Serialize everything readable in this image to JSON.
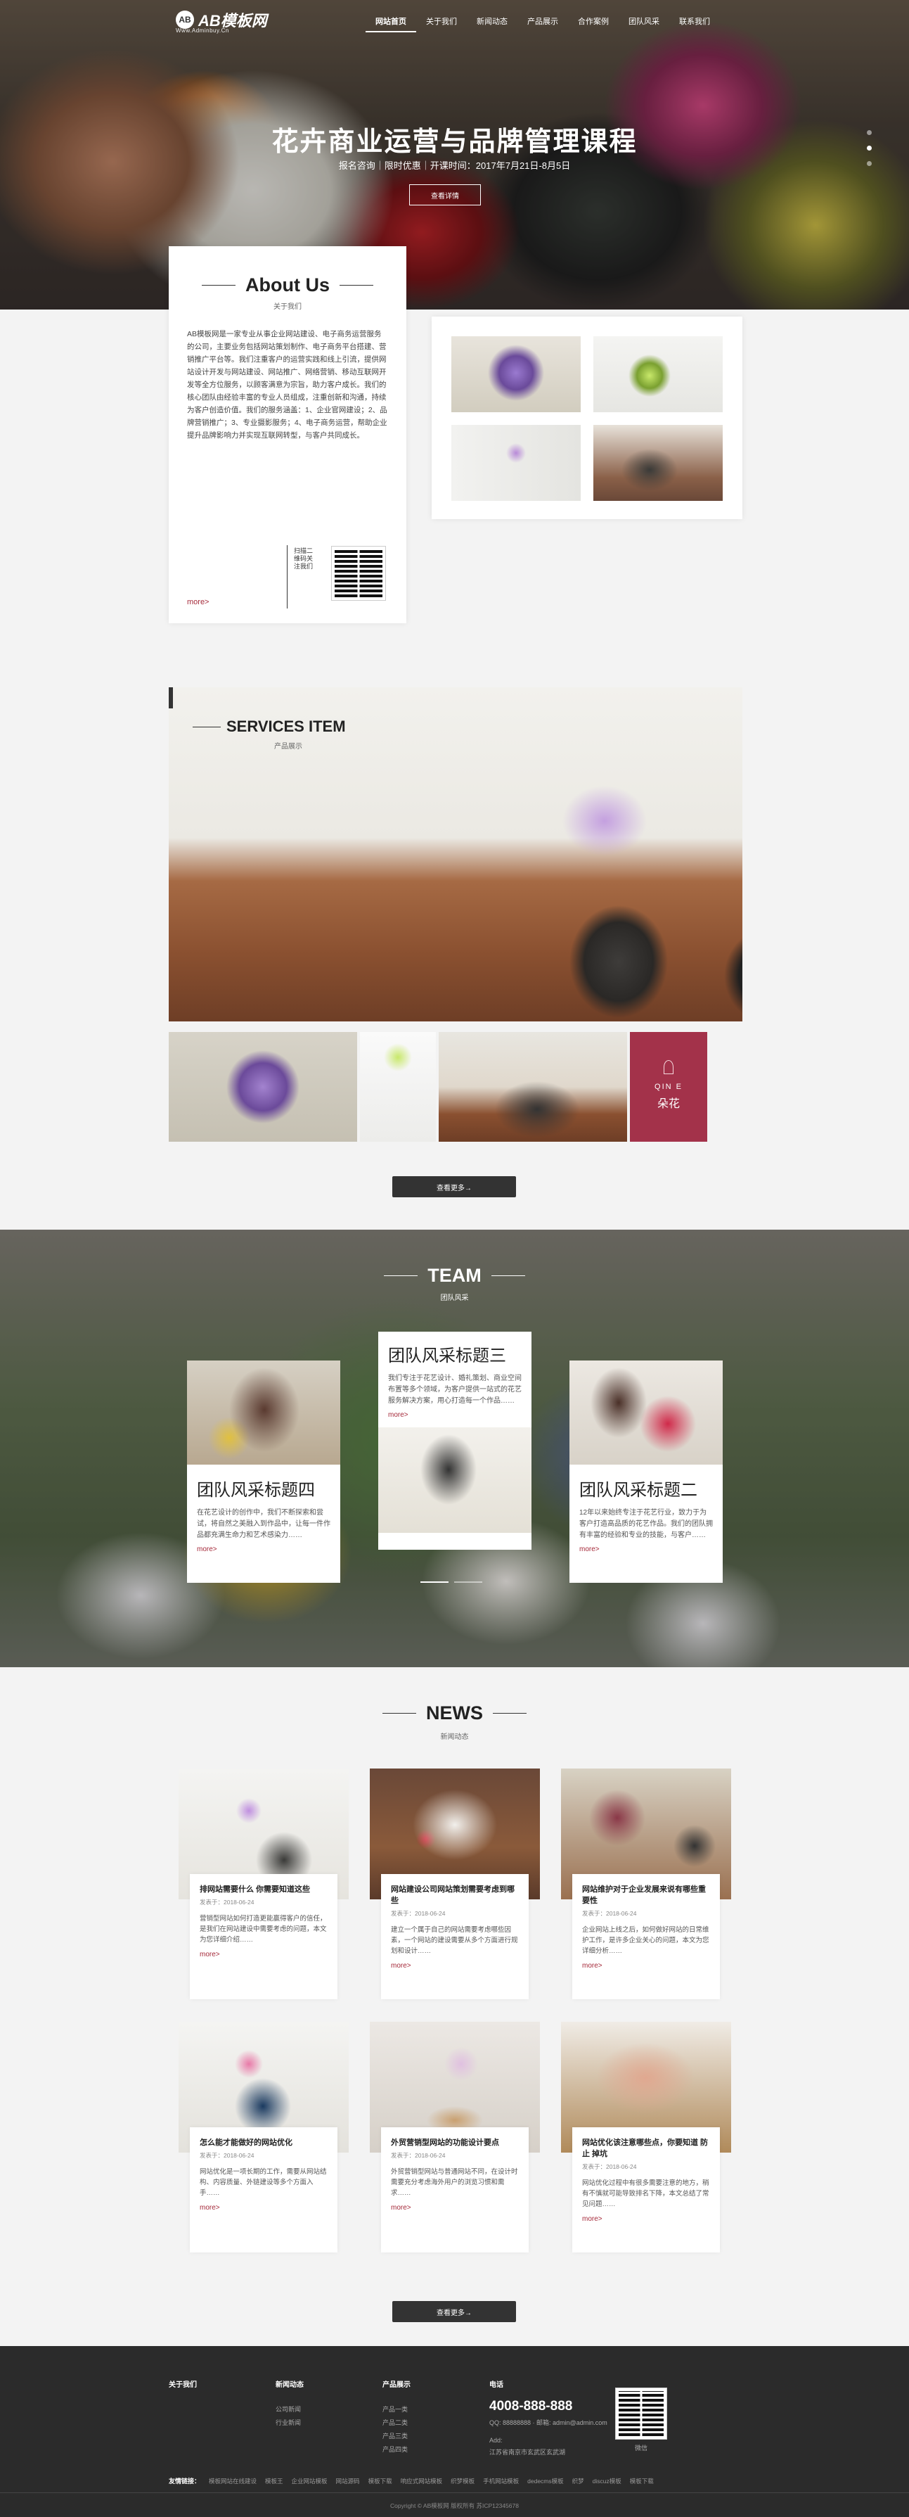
{
  "header": {
    "logo_mark": "AB",
    "logo_text": "AB模板网",
    "logo_sub": "Www.Adminbuy.Cn",
    "nav": [
      "网站首页",
      "关于我们",
      "新闻动态",
      "产品展示",
      "合作案例",
      "团队风采",
      "联系我们"
    ],
    "active_index": 0
  },
  "hero": {
    "title": "花卉商业运营与品牌管理课程",
    "subtitle": "报名咨询｜限时优惠｜开课时间：2017年7月21日-8月5日",
    "button": "查看详情"
  },
  "about": {
    "title": "About Us",
    "subtitle": "关于我们",
    "text": "AB模板网是一家专业从事企业网站建设、电子商务运营服务的公司，主要业务包括网站策划制作、电子商务平台搭建、营销推广平台等。我们注重客户的运营实践和线上引流，提供网站设计开发与网站建设、网站推广、网络营销、移动互联网开发等全方位服务，以顾客满意为宗旨，助力客户成长。我们的核心团队由经验丰富的专业人员组成，注重创新和沟通，持续为客户创造价值。我们的服务涵盖：1、企业官网建设；2、品牌营销推广；3、专业摄影服务；4、电子商务运营，帮助企业提升品牌影响力并实现互联网转型，与客户共同成长。",
    "qr_caption": "扫描二维码关注我们",
    "more": "more>"
  },
  "services": {
    "title": "SERVICES ITEM",
    "subtitle": "产品展示",
    "brand_en": "QIN E",
    "brand_cn": "朵花",
    "button": "查看更多→"
  },
  "team": {
    "title": "TEAM",
    "subtitle": "团队风采",
    "cards": [
      {
        "title": "团队风采标题四",
        "text": "在花艺设计的创作中，我们不断探索和尝试，将自然之美融入到作品中，让每一件作品都充满生命力和艺术感染力……",
        "more": "more>"
      },
      {
        "title": "团队风采标题三",
        "text": "我们专注于花艺设计、婚礼策划、商业空间布置等多个领域，为客户提供一站式的花艺服务解决方案，用心打造每一个作品……",
        "more": "more>"
      },
      {
        "title": "团队风采标题二",
        "text": "12年以来始终专注于花艺行业，致力于为客户打造高品质的花艺作品。我们的团队拥有丰富的经验和专业的技能，与客户……",
        "more": "more>"
      }
    ]
  },
  "news": {
    "title": "NEWS",
    "subtitle": "新闻动态",
    "button": "查看更多→",
    "items": [
      {
        "title": "排网站需要什么 你需要知道这些",
        "date": "发表于：2018-06-24",
        "text": "营销型网站如何打造更能赢得客户的信任，是我们在网站建设中需要考虑的问题，本文为您详细介绍……",
        "more": "more>"
      },
      {
        "title": "网站建设公司网站策划需要考虑到哪些",
        "date": "发表于：2018-06-24",
        "text": "建立一个属于自己的网站需要考虑哪些因素，一个网站的建设需要从多个方面进行规划和设计……",
        "more": "more>"
      },
      {
        "title": "网站维护对于企业发展来说有哪些重要性",
        "date": "发表于：2018-06-24",
        "text": "企业网站上线之后，如何做好网站的日常维护工作，是许多企业关心的问题，本文为您详细分析……",
        "more": "more>"
      },
      {
        "title": "怎么能才能做好的网站优化",
        "date": "发表于：2018-06-24",
        "text": "网站优化是一项长期的工作，需要从网站结构、内容质量、外链建设等多个方面入手……",
        "more": "more>"
      },
      {
        "title": "外贸营销型网站的功能设计要点",
        "date": "发表于：2018-06-24",
        "text": "外贸营销型网站与普通网站不同，在设计时需要充分考虑海外用户的浏览习惯和需求……",
        "more": "more>"
      },
      {
        "title": "网站优化该注意哪些点，你要知道 防止 掉坑",
        "date": "发表于：2018-06-24",
        "text": "网站优化过程中有很多需要注意的地方，稍有不慎就可能导致排名下降，本文总结了常见问题……",
        "more": "more>"
      }
    ]
  },
  "footer": {
    "col1_title": "关于我们",
    "col2_title": "新闻动态",
    "col2_items": [
      "公司新闻",
      "行业新闻"
    ],
    "col3_title": "产品展示",
    "col3_items": [
      "产品一类",
      "产品二类",
      "产品三类",
      "产品四类"
    ],
    "contact_title": "电话",
    "phone": "4008-888-888",
    "contact_lines": [
      "QQ: 88888888 · 邮箱: admin@admin.com",
      "Add:",
      "江苏省南京市玄武区玄武湖"
    ],
    "qr_label": "微信",
    "friend_label": "友情链接：",
    "friend_links": [
      "模板网站在线建设",
      "模板王",
      "企业网站模板",
      "网站源码",
      "模板下载",
      "响应式网站模板",
      "织梦模板",
      "手机网站模板",
      "dedecms模板",
      "织梦",
      "discuz模板",
      "模板下载"
    ],
    "copyright": "Copyright © AB模板网 版权所有 苏ICP12345678"
  }
}
